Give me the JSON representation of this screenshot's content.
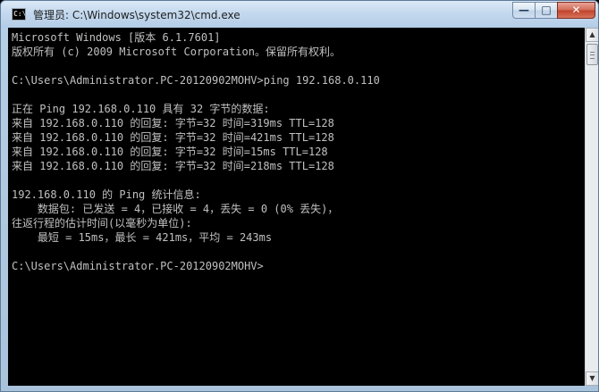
{
  "window": {
    "title": "管理员: C:\\Windows\\system32\\cmd.exe",
    "icon": "cmd-icon",
    "controls": {
      "minimize": "minimize-icon",
      "maximize": "maximize-icon",
      "close": "close-icon"
    }
  },
  "console": {
    "lines": [
      "Microsoft Windows [版本 6.1.7601]",
      "版权所有 (c) 2009 Microsoft Corporation。保留所有权利。",
      "",
      "C:\\Users\\Administrator.PC-20120902MOHV>ping 192.168.0.110",
      "",
      "正在 Ping 192.168.0.110 具有 32 字节的数据:",
      "来自 192.168.0.110 的回复: 字节=32 时间=319ms TTL=128",
      "来自 192.168.0.110 的回复: 字节=32 时间=421ms TTL=128",
      "来自 192.168.0.110 的回复: 字节=32 时间=15ms TTL=128",
      "来自 192.168.0.110 的回复: 字节=32 时间=218ms TTL=128",
      "",
      "192.168.0.110 的 Ping 统计信息:",
      "    数据包: 已发送 = 4，已接收 = 4，丢失 = 0 (0% 丢失)，",
      "往返行程的估计时间(以毫秒为单位):",
      "    最短 = 15ms，最长 = 421ms，平均 = 243ms",
      "",
      "C:\\Users\\Administrator.PC-20120902MOHV>",
      "",
      "",
      "",
      "",
      "",
      "",
      ""
    ]
  },
  "colors": {
    "console_bg": "#000000",
    "console_fg": "#c0c0c0",
    "close_button": "#c0422b"
  }
}
